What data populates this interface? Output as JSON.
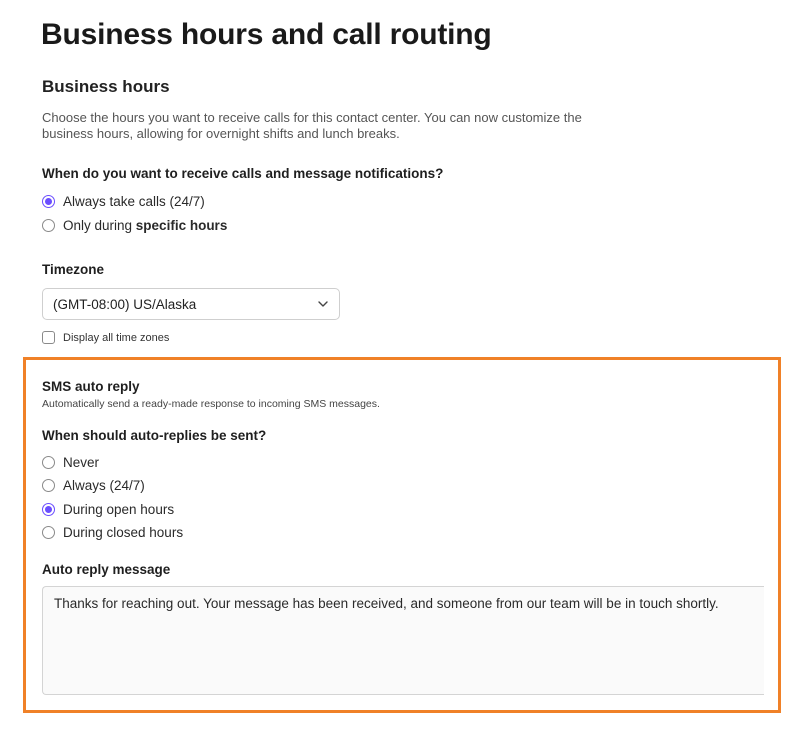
{
  "page": {
    "title": "Business hours and call routing"
  },
  "business_hours": {
    "heading": "Business hours",
    "description": "Choose the hours you want to receive calls for this contact center. You can now customize the business hours, allowing for overnight shifts and lunch breaks.",
    "question": "When do you want to receive calls and message notifications?",
    "options": [
      {
        "label": "Always take calls (24/7)",
        "checked": true
      },
      {
        "label_prefix": "Only during ",
        "label_bold": "specific hours",
        "checked": false
      }
    ]
  },
  "timezone": {
    "label": "Timezone",
    "selected": "(GMT-08:00) US/Alaska",
    "icon": "chevron-down-icon",
    "show_all_label": "Display all time zones",
    "show_all_checked": false
  },
  "sms": {
    "heading": "SMS auto reply",
    "description": "Automatically send a ready-made response to incoming SMS messages.",
    "question": "When should auto-replies be sent?",
    "options": [
      {
        "label": "Never",
        "checked": false
      },
      {
        "label": "Always (24/7)",
        "checked": false
      },
      {
        "label": "During open hours",
        "checked": true
      },
      {
        "label": "During closed hours",
        "checked": false
      }
    ],
    "message_label": "Auto reply message",
    "message_value": "Thanks for reaching out. Your message has been received, and someone from our team will be in touch shortly."
  },
  "colors": {
    "accent": "#6b4eff",
    "highlight": "#f08128"
  }
}
